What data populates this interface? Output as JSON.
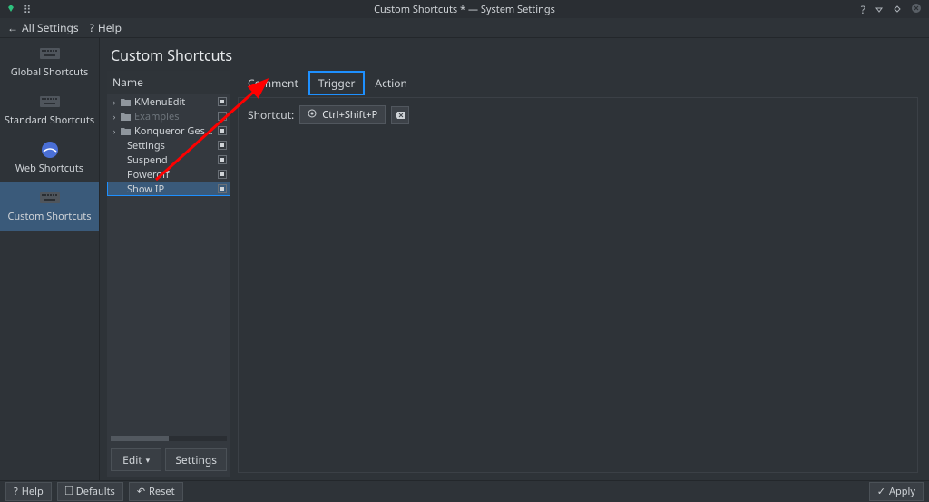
{
  "window": {
    "title": "Custom Shortcuts * — System Settings"
  },
  "toolbar": {
    "all_settings": "All Settings",
    "help": "Help"
  },
  "sidebar": {
    "items": [
      {
        "label": "Global Shortcuts"
      },
      {
        "label": "Standard Shortcuts"
      },
      {
        "label": "Web Shortcuts"
      },
      {
        "label": "Custom Shortcuts"
      }
    ]
  },
  "page": {
    "title": "Custom Shortcuts",
    "list": {
      "header": "Name",
      "rows": [
        {
          "expandable": true,
          "folder": true,
          "label": "KMenuEdit",
          "checked": true,
          "muted": false
        },
        {
          "expandable": true,
          "folder": true,
          "label": "Examples",
          "checked": false,
          "muted": true
        },
        {
          "expandable": true,
          "folder": true,
          "label": "Konqueror Gestures",
          "checked": true,
          "muted": false
        },
        {
          "expandable": false,
          "folder": false,
          "label": "Settings",
          "checked": true,
          "muted": false
        },
        {
          "expandable": false,
          "folder": false,
          "label": "Suspend",
          "checked": true,
          "muted": false
        },
        {
          "expandable": false,
          "folder": false,
          "label": "Poweroff",
          "checked": true,
          "muted": false
        },
        {
          "expandable": false,
          "folder": false,
          "label": "Show IP",
          "checked": true,
          "muted": false,
          "selected": true
        }
      ],
      "edit_button": "Edit",
      "settings_button": "Settings"
    },
    "tabs": {
      "comment": "Comment",
      "trigger": "Trigger",
      "action": "Action"
    },
    "trigger": {
      "label": "Shortcut:",
      "value": "Ctrl+Shift+P"
    }
  },
  "bottom": {
    "help": "Help",
    "defaults": "Defaults",
    "reset": "Reset",
    "apply": "Apply"
  }
}
